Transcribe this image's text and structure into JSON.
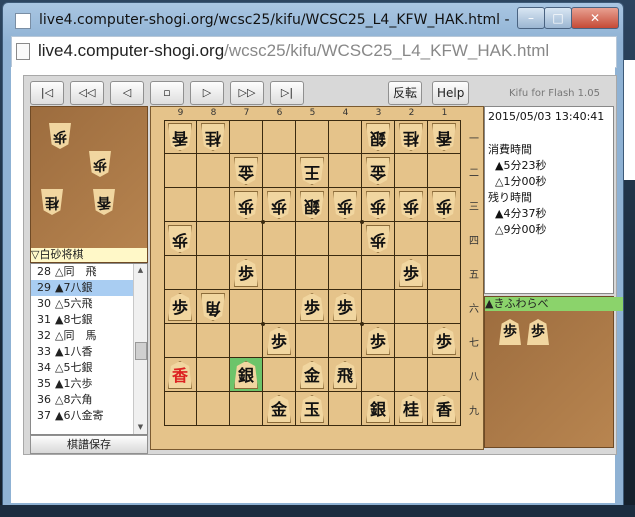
{
  "window": {
    "title": "live4.computer-shogi.org/wcsc25/kifu/WCSC25_L4_KFW_HAK.html - Google ...",
    "min_label": "–",
    "max_label": "□",
    "close_label": "✕"
  },
  "address": {
    "domain": "live4.computer-shogi.org",
    "path": "/wcsc25/kifu/WCSC25_L4_KFW_HAK.html"
  },
  "toolbar": {
    "first": "|◁",
    "back10": "◁◁",
    "back": "◁",
    "stop": "▫",
    "forward": "▷",
    "forward10": "▷▷",
    "last": "▷|",
    "flip": "反転",
    "help": "Help",
    "app_name": "Kifu for Flash 1.05"
  },
  "gote": {
    "name": "▽白砂将棋",
    "hand": [
      "歩",
      "歩",
      "桂",
      "香"
    ]
  },
  "sente": {
    "name": "▲きふわらべ",
    "hand": [
      "歩",
      "歩"
    ]
  },
  "moves": [
    {
      "no": "28",
      "text": "△同　飛"
    },
    {
      "no": "29",
      "text": "▲7八銀"
    },
    {
      "no": "30",
      "text": "△5六飛"
    },
    {
      "no": "31",
      "text": "▲8七銀"
    },
    {
      "no": "32",
      "text": "△同　馬"
    },
    {
      "no": "33",
      "text": "▲1八香"
    },
    {
      "no": "34",
      "text": "△5七銀"
    },
    {
      "no": "35",
      "text": "▲1六歩"
    },
    {
      "no": "36",
      "text": "△8六角"
    },
    {
      "no": "37",
      "text": "▲6八金寄"
    }
  ],
  "selected_move_index": 1,
  "save_label": "棋譜保存",
  "info": {
    "datetime": "2015/05/03 13:40:41",
    "elapsed_label": "消費時間",
    "sente_elapsed": "▲5分23秒",
    "gote_elapsed": "△1分00秒",
    "remaining_label": "残り時間",
    "sente_remaining": "▲4分37秒",
    "gote_remaining": "△9分00秒"
  },
  "board": {
    "file_labels": [
      "9",
      "8",
      "7",
      "6",
      "5",
      "4",
      "3",
      "2",
      "1"
    ],
    "rank_labels": [
      "一",
      "二",
      "三",
      "四",
      "五",
      "六",
      "七",
      "八",
      "九"
    ],
    "highlight": "7八",
    "pieces": [
      {
        "sq": "9一",
        "p": "香",
        "side": "g"
      },
      {
        "sq": "8一",
        "p": "桂",
        "side": "g"
      },
      {
        "sq": "3一",
        "p": "銀",
        "side": "g"
      },
      {
        "sq": "2一",
        "p": "桂",
        "side": "g"
      },
      {
        "sq": "1一",
        "p": "香",
        "side": "g"
      },
      {
        "sq": "5二",
        "p": "王",
        "side": "g"
      },
      {
        "sq": "7二",
        "p": "金",
        "side": "g"
      },
      {
        "sq": "3二",
        "p": "金",
        "side": "g"
      },
      {
        "sq": "7三",
        "p": "歩",
        "side": "g"
      },
      {
        "sq": "6三",
        "p": "歩",
        "side": "g"
      },
      {
        "sq": "5三",
        "p": "銀",
        "side": "g"
      },
      {
        "sq": "4三",
        "p": "歩",
        "side": "g"
      },
      {
        "sq": "3三",
        "p": "歩",
        "side": "g"
      },
      {
        "sq": "2三",
        "p": "歩",
        "side": "g"
      },
      {
        "sq": "1三",
        "p": "歩",
        "side": "g"
      },
      {
        "sq": "9四",
        "p": "歩",
        "side": "g"
      },
      {
        "sq": "3四",
        "p": "歩",
        "side": "g"
      },
      {
        "sq": "7五",
        "p": "歩",
        "side": "s"
      },
      {
        "sq": "2五",
        "p": "歩",
        "side": "s"
      },
      {
        "sq": "9六",
        "p": "歩",
        "side": "s"
      },
      {
        "sq": "8六",
        "p": "角",
        "side": "g"
      },
      {
        "sq": "5六",
        "p": "歩",
        "side": "s"
      },
      {
        "sq": "4六",
        "p": "歩",
        "side": "s"
      },
      {
        "sq": "6七",
        "p": "歩",
        "side": "s"
      },
      {
        "sq": "3七",
        "p": "歩",
        "side": "s"
      },
      {
        "sq": "1七",
        "p": "歩",
        "side": "s"
      },
      {
        "sq": "9八",
        "p": "香",
        "side": "s",
        "prom": true
      },
      {
        "sq": "7八",
        "p": "銀",
        "side": "s"
      },
      {
        "sq": "5八",
        "p": "金",
        "side": "s"
      },
      {
        "sq": "4八",
        "p": "飛",
        "side": "s"
      },
      {
        "sq": "6九",
        "p": "金",
        "side": "s"
      },
      {
        "sq": "5九",
        "p": "玉",
        "side": "s"
      },
      {
        "sq": "3九",
        "p": "銀",
        "side": "s"
      },
      {
        "sq": "2九",
        "p": "桂",
        "side": "s"
      },
      {
        "sq": "1九",
        "p": "香",
        "side": "s"
      }
    ]
  }
}
